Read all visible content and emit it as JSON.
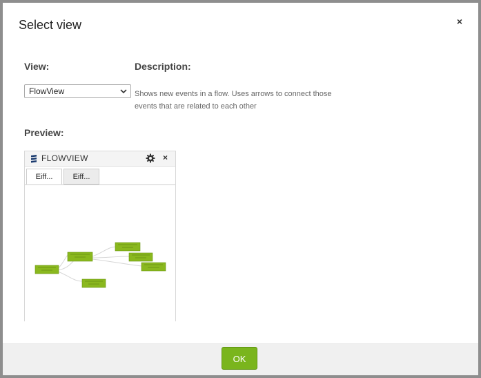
{
  "dialog": {
    "title": "Select view",
    "close_glyph": "×"
  },
  "form": {
    "view_label": "View:",
    "description_label": "Description:",
    "selected_view": "FlowView",
    "description_line1": "Shows new events in a flow. Uses arrows to connect those",
    "description_line2": "events that are related to each other",
    "preview_label": "Preview:"
  },
  "preview": {
    "title": "FLOWVIEW",
    "close_glyph": "×",
    "tabs": [
      {
        "label": "Eiff..."
      },
      {
        "label": "Eiff..."
      }
    ]
  },
  "footer": {
    "ok_label": "OK"
  },
  "colors": {
    "accent": "#7ab51d",
    "node_fill": "#8ab81e",
    "edge": "#d6d6d6"
  },
  "icons": {
    "close": "close-icon",
    "chevron": "chevron-down-icon",
    "logo": "logo-icon",
    "settings": "gear-icon"
  }
}
